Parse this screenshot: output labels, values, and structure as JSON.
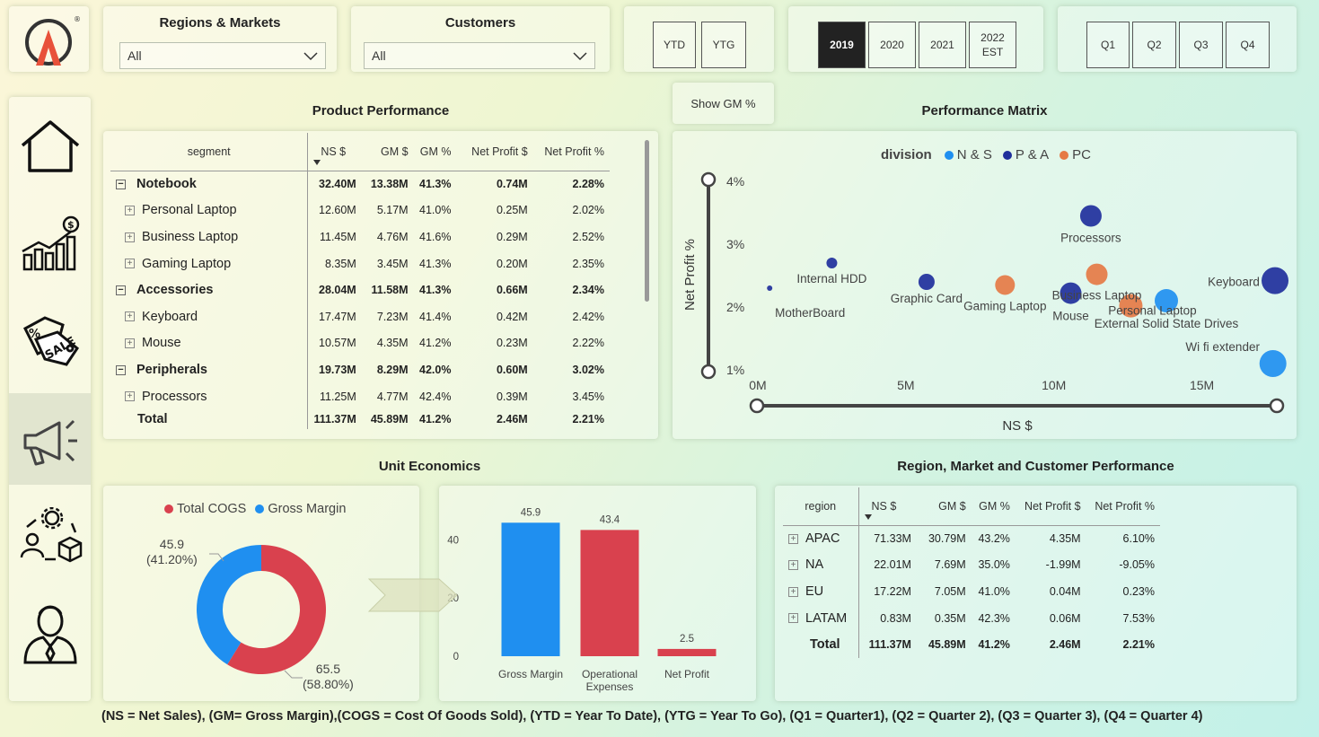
{
  "slicers": {
    "regions": {
      "title": "Regions & Markets",
      "value": "All"
    },
    "customers": {
      "title": "Customers",
      "value": "All"
    }
  },
  "period_buttons": [
    "YTD",
    "YTG"
  ],
  "year_buttons": [
    {
      "label": "2019",
      "active": true
    },
    {
      "label": "2020",
      "active": false
    },
    {
      "label": "2021",
      "active": false
    },
    {
      "label": "2022\nEST",
      "active": false
    }
  ],
  "quarter_buttons": [
    "Q1",
    "Q2",
    "Q3",
    "Q4"
  ],
  "nav_icons": [
    "home-icon",
    "finance-chart-icon",
    "sales-tag-icon",
    "marketing-megaphone-icon",
    "supply-chain-icon",
    "executive-icon"
  ],
  "show_gm_button": "Show GM %",
  "product_performance": {
    "title": "Product Performance",
    "columns": [
      "segment",
      "NS $",
      "GM $",
      "GM %",
      "Net Profit $",
      "Net Profit %"
    ],
    "rows": [
      {
        "label": "Notebook",
        "level": 0,
        "values": [
          "32.40M",
          "13.38M",
          "41.3%",
          "0.74M",
          "2.28%"
        ]
      },
      {
        "label": "Personal Laptop",
        "level": 1,
        "values": [
          "12.60M",
          "5.17M",
          "41.0%",
          "0.25M",
          "2.02%"
        ]
      },
      {
        "label": "Business Laptop",
        "level": 1,
        "values": [
          "11.45M",
          "4.76M",
          "41.6%",
          "0.29M",
          "2.52%"
        ]
      },
      {
        "label": "Gaming Laptop",
        "level": 1,
        "values": [
          "8.35M",
          "3.45M",
          "41.3%",
          "0.20M",
          "2.35%"
        ]
      },
      {
        "label": "Accessories",
        "level": 0,
        "values": [
          "28.04M",
          "11.58M",
          "41.3%",
          "0.66M",
          "2.34%"
        ]
      },
      {
        "label": "Keyboard",
        "level": 1,
        "values": [
          "17.47M",
          "7.23M",
          "41.4%",
          "0.42M",
          "2.42%"
        ]
      },
      {
        "label": "Mouse",
        "level": 1,
        "values": [
          "10.57M",
          "4.35M",
          "41.2%",
          "0.23M",
          "2.22%"
        ]
      },
      {
        "label": "Peripherals",
        "level": 0,
        "values": [
          "19.73M",
          "8.29M",
          "42.0%",
          "0.60M",
          "3.02%"
        ]
      },
      {
        "label": "Processors",
        "level": 1,
        "values": [
          "11.25M",
          "4.77M",
          "42.4%",
          "0.39M",
          "3.45%"
        ]
      }
    ],
    "total": {
      "label": "Total",
      "values": [
        "111.37M",
        "45.89M",
        "41.2%",
        "2.46M",
        "2.21%"
      ]
    }
  },
  "performance_matrix": {
    "title": "Performance Matrix",
    "legend_title": "division",
    "legend": [
      {
        "name": "N & S",
        "color": "#1f8ff0"
      },
      {
        "name": "P & A",
        "color": "#1f2f9c"
      },
      {
        "name": "PC",
        "color": "#e57a45"
      }
    ]
  },
  "unit_economics": {
    "title": "Unit Economics",
    "legend": [
      {
        "name": "Total COGS",
        "color": "#d9414e"
      },
      {
        "name": "Gross Margin",
        "color": "#1f8ff0"
      }
    ],
    "donut_labels": [
      {
        "value": "45.9",
        "pct": "(41.20%)"
      },
      {
        "value": "65.5",
        "pct": "(58.80%)"
      }
    ]
  },
  "region_performance": {
    "title": "Region, Market and Customer Performance",
    "columns": [
      "region",
      "NS $",
      "GM $",
      "GM %",
      "Net Profit $",
      "Net Profit %"
    ],
    "rows": [
      {
        "label": "APAC",
        "values": [
          "71.33M",
          "30.79M",
          "43.2%",
          "4.35M",
          "6.10%"
        ]
      },
      {
        "label": "NA",
        "values": [
          "22.01M",
          "7.69M",
          "35.0%",
          "-1.99M",
          "-9.05%"
        ]
      },
      {
        "label": "EU",
        "values": [
          "17.22M",
          "7.05M",
          "41.0%",
          "0.04M",
          "0.23%"
        ]
      },
      {
        "label": "LATAM",
        "values": [
          "0.83M",
          "0.35M",
          "42.3%",
          "0.06M",
          "7.53%"
        ]
      }
    ],
    "total": {
      "label": "Total",
      "values": [
        "111.37M",
        "45.89M",
        "41.2%",
        "2.46M",
        "2.21%"
      ]
    }
  },
  "footer": "(NS = Net Sales), (GM= Gross Margin),(COGS = Cost Of Goods Sold), (YTD = Year To Date), (YTG = Year To Go), (Q1 = Quarter1), (Q2 = Quarter 2), (Q3 = Quarter 3), (Q4 = Quarter 4)",
  "chart_data": [
    {
      "type": "scatter",
      "title": "Performance Matrix",
      "xlabel": "NS $",
      "ylabel": "Net Profit %",
      "xlim": [
        0,
        17.5
      ],
      "ylim": [
        1,
        4
      ],
      "x_ticks": [
        "0M",
        "5M",
        "10M",
        "15M"
      ],
      "y_ticks": [
        "1%",
        "2%",
        "3%",
        "4%"
      ],
      "series": [
        {
          "name": "N & S",
          "color": "#1f8ff0",
          "points": [
            {
              "label": "External Solid State Drives",
              "x": 13.8,
              "y": 2.1
            },
            {
              "label": "Wi fi extender",
              "x": 17.4,
              "y": 1.1
            }
          ]
        },
        {
          "name": "P & A",
          "color": "#1f2f9c",
          "points": [
            {
              "label": "Processors",
              "x": 11.25,
              "y": 3.45
            },
            {
              "label": "Internal HDD",
              "x": 2.5,
              "y": 2.7
            },
            {
              "label": "MotherBoard",
              "x": 0.4,
              "y": 2.3
            },
            {
              "label": "Graphic Card",
              "x": 5.7,
              "y": 2.4
            },
            {
              "label": "Mouse",
              "x": 10.57,
              "y": 2.22
            },
            {
              "label": "Keyboard",
              "x": 17.47,
              "y": 2.42
            }
          ]
        },
        {
          "name": "PC",
          "color": "#e57a45",
          "points": [
            {
              "label": "Gaming Laptop",
              "x": 8.35,
              "y": 2.35
            },
            {
              "label": "Business Laptop",
              "x": 11.45,
              "y": 2.52
            },
            {
              "label": "Personal Laptop",
              "x": 12.6,
              "y": 2.02
            }
          ]
        }
      ]
    },
    {
      "type": "pie",
      "title": "Unit Economics",
      "labels": [
        "Gross Margin",
        "Total COGS"
      ],
      "values": [
        45.9,
        65.5
      ],
      "percents": [
        "41.20%",
        "58.80%"
      ],
      "colors": [
        "#1f8ff0",
        "#d9414e"
      ]
    },
    {
      "type": "bar",
      "categories": [
        "Gross Margin",
        "Operational\nExpenses",
        "Net Profit"
      ],
      "values": [
        45.9,
        43.4,
        2.5
      ],
      "colors": [
        "#1f8ff0",
        "#d9414e",
        "#d9414e"
      ],
      "y_ticks": [
        "0",
        "20",
        "40"
      ],
      "ylim": [
        0,
        50
      ]
    }
  ]
}
